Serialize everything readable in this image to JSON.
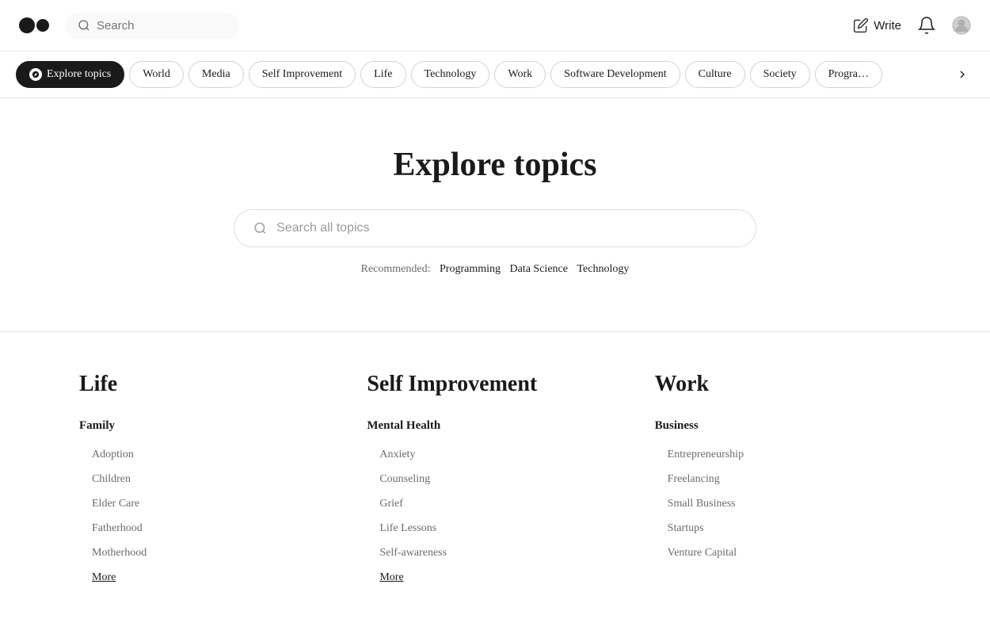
{
  "header": {
    "search_placeholder": "Search",
    "write_label": "Write"
  },
  "nav": {
    "active_label": "Explore topics",
    "tags": [
      "World",
      "Media",
      "Self Improvement",
      "Life",
      "Technology",
      "Work",
      "Software Development",
      "Culture",
      "Society",
      "Programming"
    ]
  },
  "hero": {
    "title": "Explore topics",
    "search_placeholder": "Search all topics",
    "recommended_label": "Recommended:",
    "recommended_links": [
      "Programming",
      "Data Science",
      "Technology"
    ]
  },
  "categories": [
    {
      "title": "Life",
      "subcategories": [
        {
          "title": "Family",
          "topics": [
            "Adoption",
            "Children",
            "Elder Care",
            "Fatherhood",
            "Motherhood"
          ],
          "more": "More"
        }
      ]
    },
    {
      "title": "Self Improvement",
      "subcategories": [
        {
          "title": "Mental Health",
          "topics": [
            "Anxiety",
            "Counseling",
            "Grief",
            "Life Lessons",
            "Self-awareness"
          ],
          "more": "More"
        }
      ]
    },
    {
      "title": "Work",
      "subcategories": [
        {
          "title": "Business",
          "topics": [
            "Entrepreneurship",
            "Freelancing",
            "Small Business",
            "Startups",
            "Venture Capital"
          ],
          "more": null
        }
      ]
    }
  ]
}
